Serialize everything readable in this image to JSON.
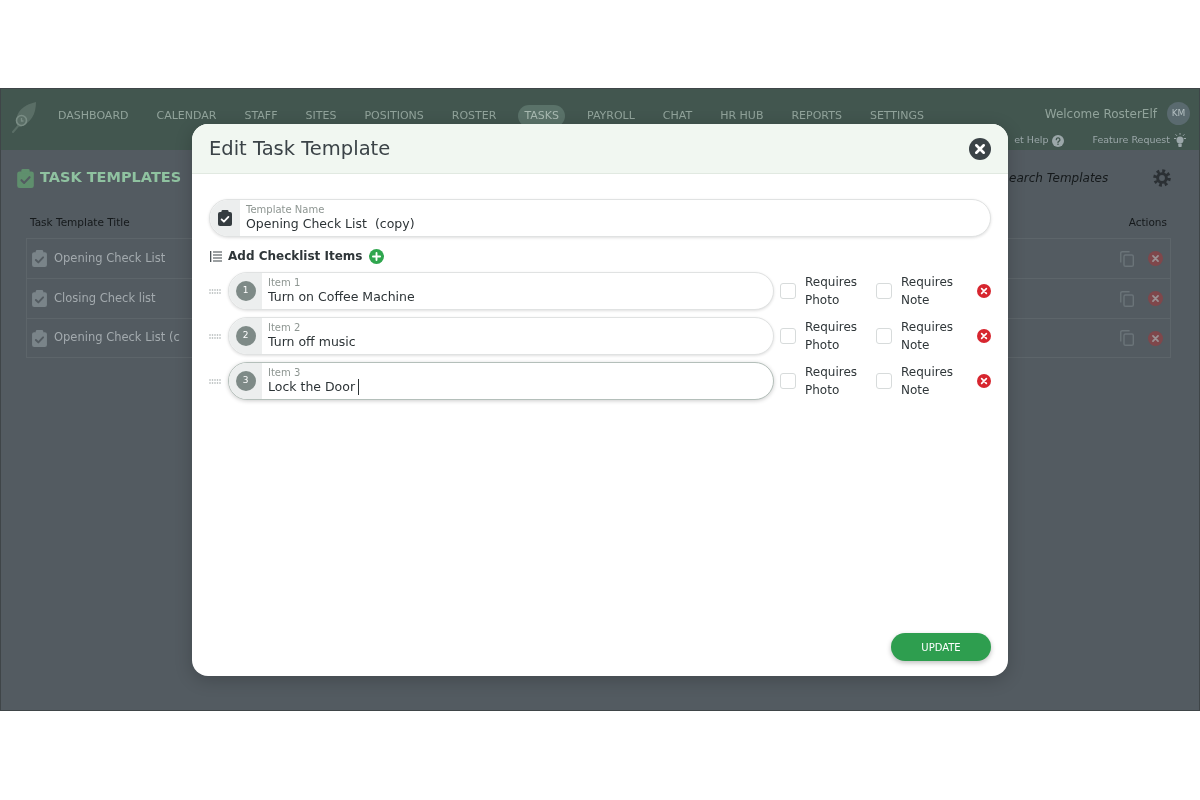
{
  "navbar": {
    "items": [
      {
        "label": "DASHBOARD",
        "selected": false
      },
      {
        "label": "CALENDAR",
        "selected": false
      },
      {
        "label": "STAFF",
        "selected": false
      },
      {
        "label": "SITES",
        "selected": false
      },
      {
        "label": "POSITIONS",
        "selected": false
      },
      {
        "label": "ROSTER",
        "selected": false
      },
      {
        "label": "TASKS",
        "selected": true
      },
      {
        "label": "PAYROLL",
        "selected": false
      },
      {
        "label": "CHAT",
        "selected": false
      },
      {
        "label": "HR HUB",
        "selected": false
      },
      {
        "label": "REPORTS",
        "selected": false
      },
      {
        "label": "SETTINGS",
        "selected": false
      }
    ],
    "welcome": "Welcome RosterElf",
    "avatar_initials": "KM",
    "help_link": "et Help",
    "feature_request_link": "Feature Request"
  },
  "page": {
    "title": "TASK TEMPLATES",
    "search": {
      "placeholder": "earch Templates"
    },
    "table": {
      "columns": [
        "Task Template Title",
        "Actions"
      ],
      "rows": [
        {
          "title": "Opening Check List"
        },
        {
          "title": "Closing Check list"
        },
        {
          "title": "Opening Check List (c"
        }
      ]
    }
  },
  "modal": {
    "title": "Edit Task Template",
    "template_name": {
      "label": "Template Name",
      "value": "Opening Check List  (copy)"
    },
    "checklist_heading": "Add Checklist Items",
    "items": [
      {
        "number": "1",
        "label": "Item 1",
        "value": "Turn on Coffee Machine",
        "focused": false,
        "requires_photo": {
          "label": "Requires Photo",
          "checked": false
        },
        "requires_note": {
          "label": "Requires Note",
          "checked": false
        }
      },
      {
        "number": "2",
        "label": "Item 2",
        "value": "Turn off music",
        "focused": false,
        "requires_photo": {
          "label": "Requires Photo",
          "checked": false
        },
        "requires_note": {
          "label": "Requires Note",
          "checked": false
        }
      },
      {
        "number": "3",
        "label": "Item 3",
        "value": "Lock the Door",
        "focused": true,
        "requires_photo": {
          "label": "Requires Photo",
          "checked": false
        },
        "requires_note": {
          "label": "Requires Note",
          "checked": false
        }
      }
    ],
    "update_button": "UPDATE"
  }
}
